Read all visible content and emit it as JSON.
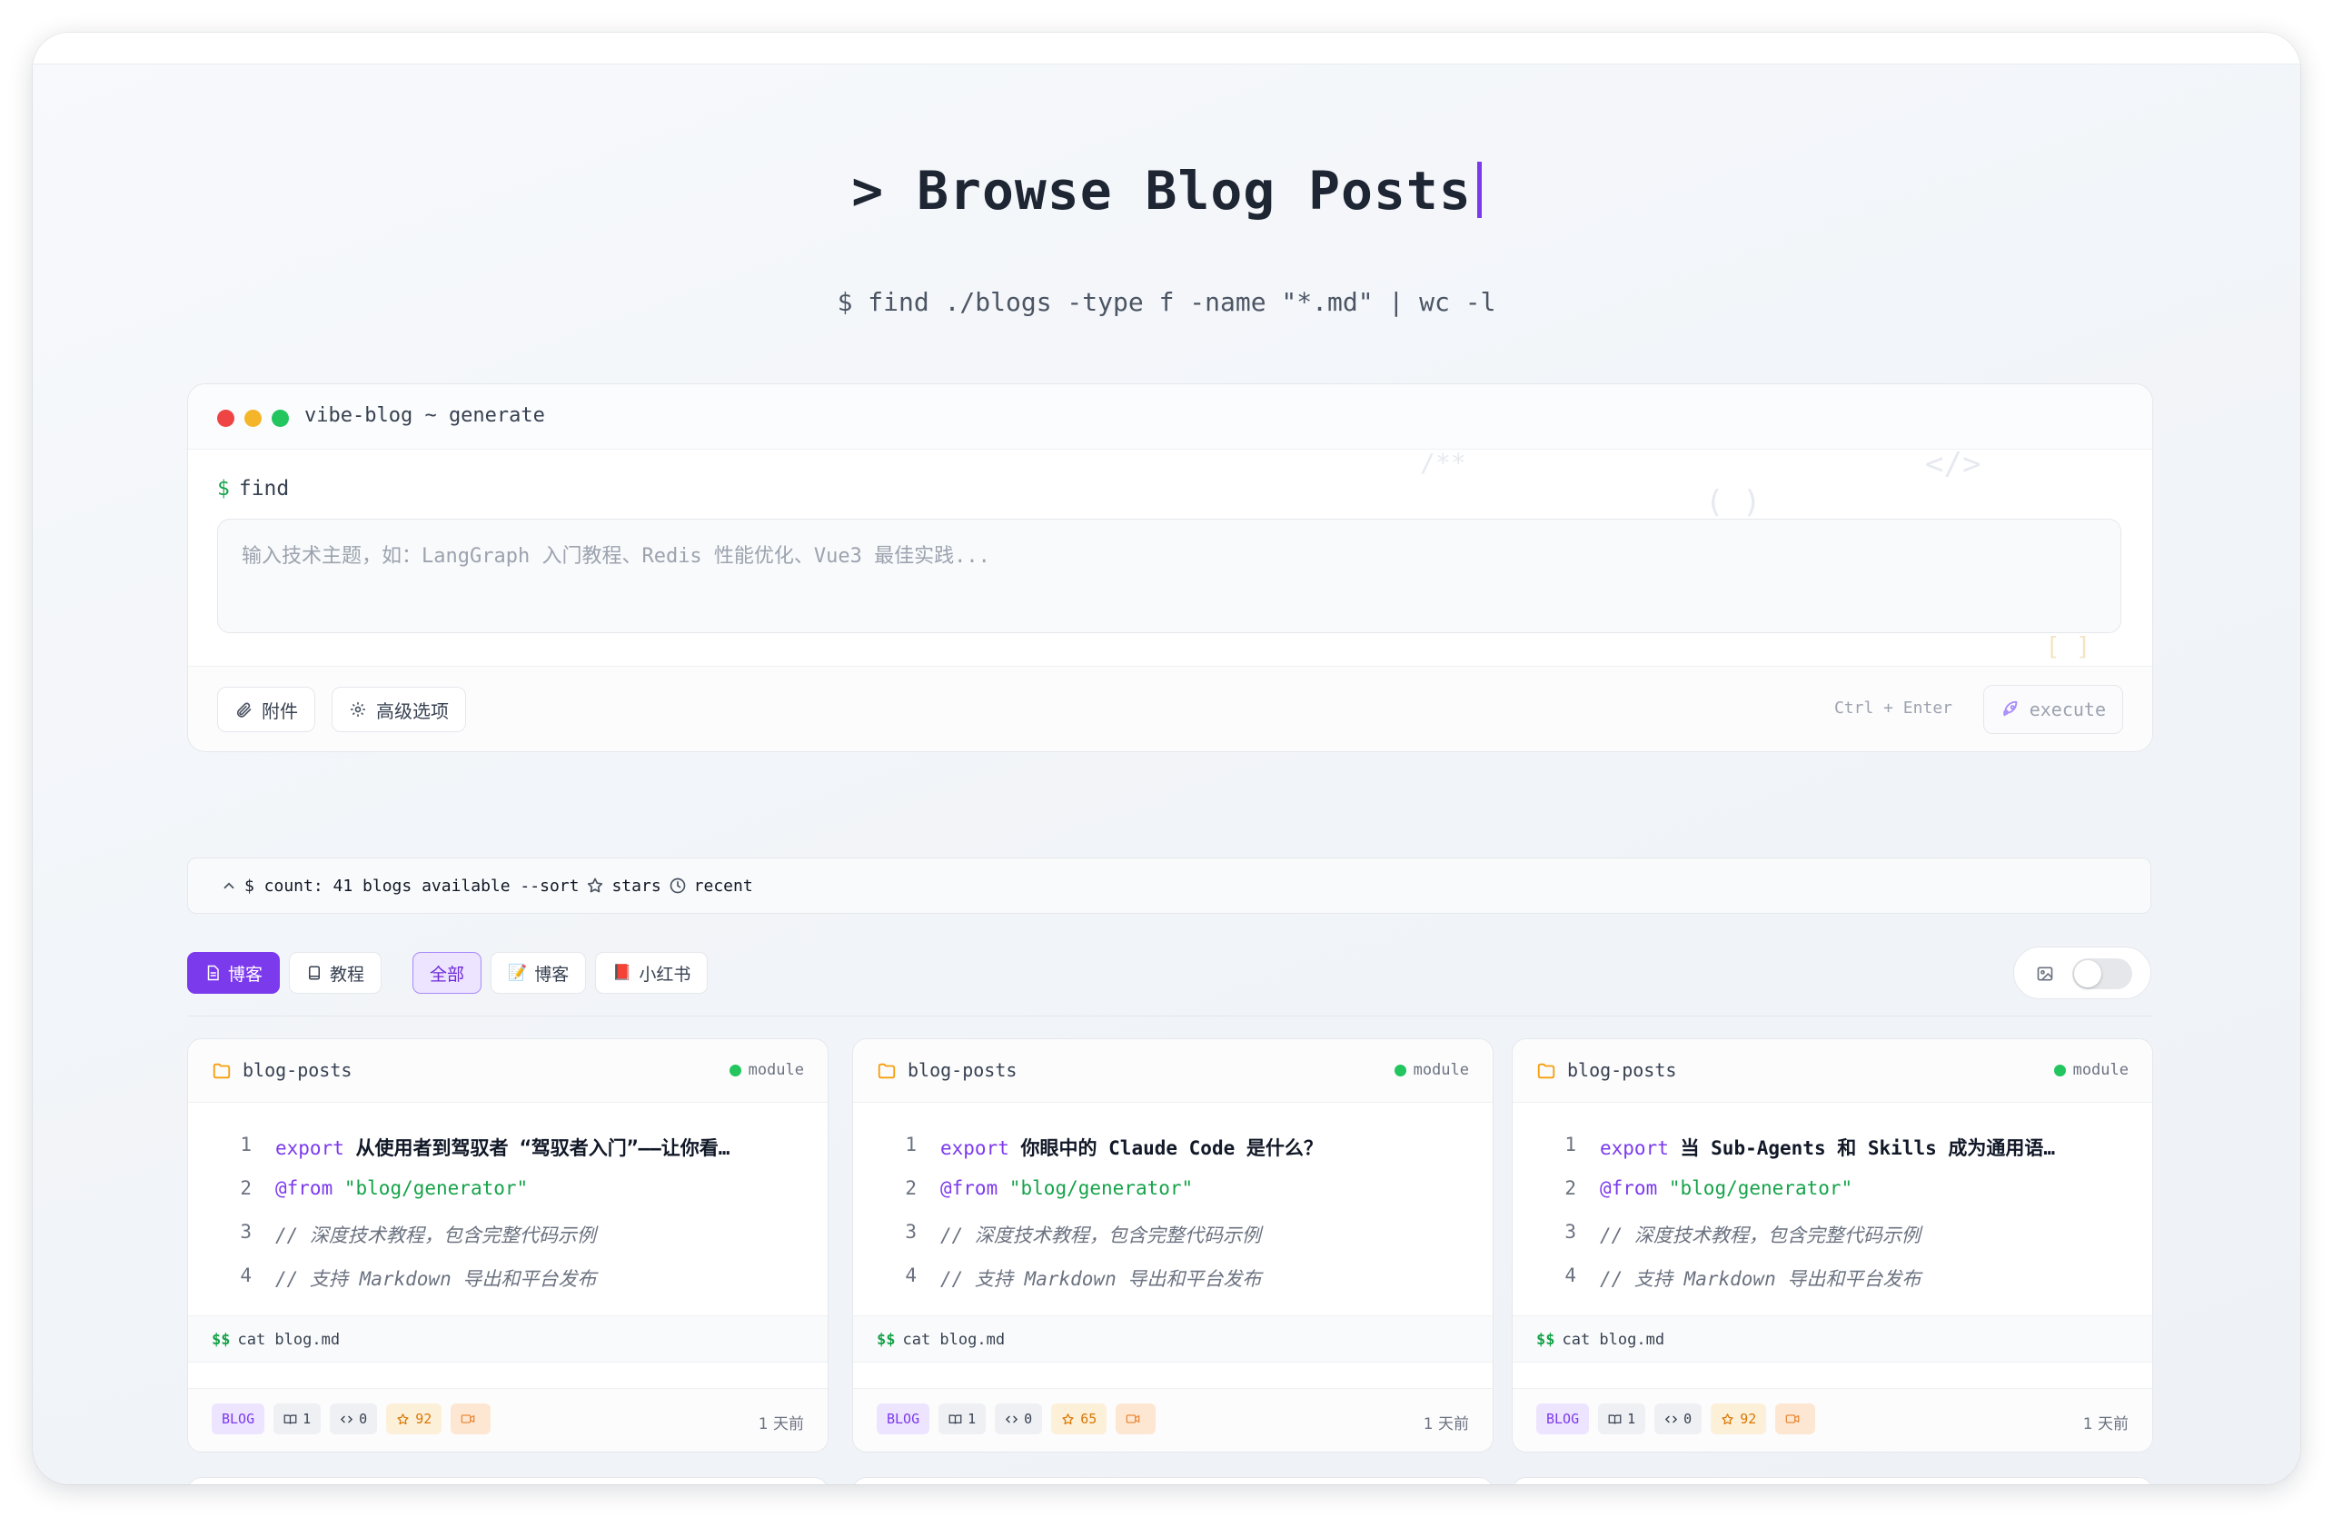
{
  "hero": {
    "prompt": ">",
    "title": "Browse Blog Posts",
    "subtitle": "$ find ./blogs -type f -name \"*.md\" | wc -l"
  },
  "generator": {
    "title": "vibe-blog ~ generate",
    "prompt_symbol": "$",
    "prompt_cmd": "find",
    "topic_value": "",
    "topic_placeholder": "输入技术主题，如：LangGraph 入门教程、Redis 性能优化、Vue3 最佳实践...",
    "attach_label": "附件",
    "advanced_label": "高级选项",
    "shortcut_hint": "Ctrl + Enter",
    "execute_label": "execute",
    "deco": [
      "/**",
      "</>",
      "( )",
      "[ ]"
    ]
  },
  "countbar": {
    "text": "$ count: 41 blogs available --sort",
    "sort_stars": "stars",
    "sort_recent": "recent"
  },
  "filters": {
    "type": [
      {
        "label": "博客",
        "state": "primary"
      },
      {
        "label": "教程",
        "state": "normal"
      }
    ],
    "source": [
      {
        "label": "全部",
        "state": "active"
      },
      {
        "label": "博客",
        "emoji": "📝",
        "state": "normal"
      },
      {
        "label": "小红书",
        "emoji": "📕",
        "state": "normal"
      }
    ]
  },
  "colors": {
    "accent": "#7c3aed",
    "success": "#16a34a",
    "dot_red": "#ef4444",
    "dot_yellow": "#f5b52a",
    "dot_green": "#22c55e"
  },
  "cards": [
    {
      "folder": "blog-posts",
      "status": "module",
      "code": [
        {
          "n": "1",
          "kw": "export",
          "title": "从使用者到驾驭者 “驾驭者入门”——让你看…"
        },
        {
          "n": "2",
          "kw": "@from",
          "str": "\"blog/generator\""
        },
        {
          "n": "3",
          "comment": "// 深度技术教程，包含完整代码示例"
        },
        {
          "n": "4",
          "comment": "// 支持 Markdown 导出和平台发布"
        }
      ],
      "cmd_symbol": "$$",
      "cmd": "cat blog.md",
      "badges": {
        "type": "BLOG",
        "chapters": "1",
        "code": "0",
        "stars": "92"
      },
      "ago": "1 天前"
    },
    {
      "folder": "blog-posts",
      "status": "module",
      "code": [
        {
          "n": "1",
          "kw": "export",
          "title": "你眼中的 Claude Code 是什么？"
        },
        {
          "n": "2",
          "kw": "@from",
          "str": "\"blog/generator\""
        },
        {
          "n": "3",
          "comment": "// 深度技术教程，包含完整代码示例"
        },
        {
          "n": "4",
          "comment": "// 支持 Markdown 导出和平台发布"
        }
      ],
      "cmd_symbol": "$$",
      "cmd": "cat blog.md",
      "badges": {
        "type": "BLOG",
        "chapters": "1",
        "code": "0",
        "stars": "65"
      },
      "ago": "1 天前"
    },
    {
      "folder": "blog-posts",
      "status": "module",
      "code": [
        {
          "n": "1",
          "kw": "export",
          "title": "当 Sub-Agents 和 Skills 成为通用语…"
        },
        {
          "n": "2",
          "kw": "@from",
          "str": "\"blog/generator\""
        },
        {
          "n": "3",
          "comment": "// 深度技术教程，包含完整代码示例"
        },
        {
          "n": "4",
          "comment": "// 支持 Markdown 导出和平台发布"
        }
      ],
      "cmd_symbol": "$$",
      "cmd": "cat blog.md",
      "badges": {
        "type": "BLOG",
        "chapters": "1",
        "code": "0",
        "stars": "92"
      },
      "ago": "1 天前"
    }
  ]
}
